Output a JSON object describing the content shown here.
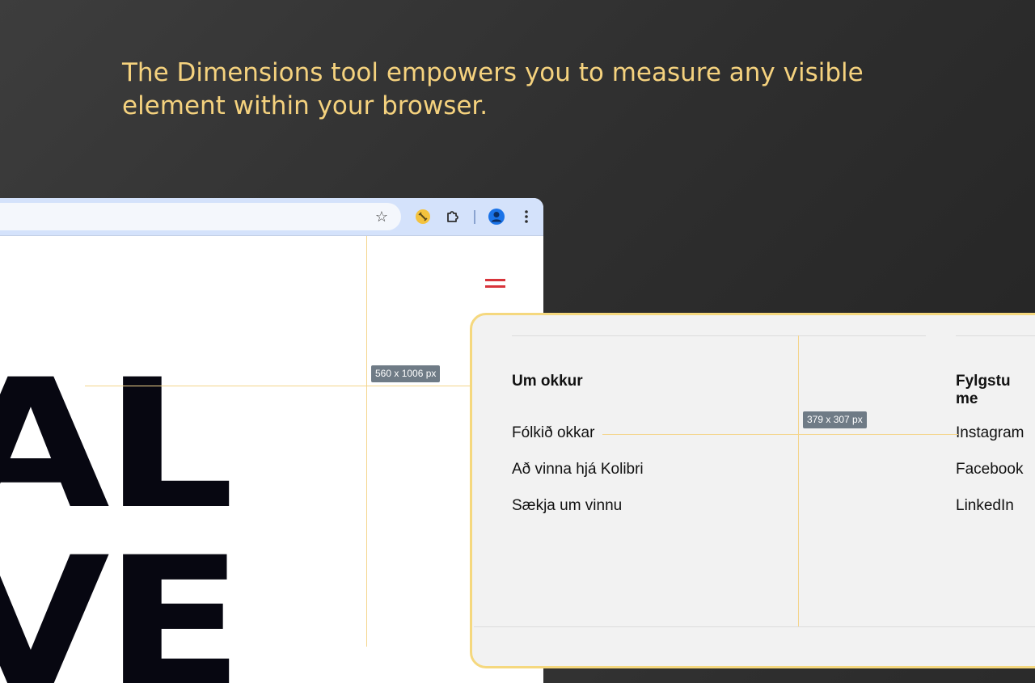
{
  "headline": "The Dimensions tool empowers you to measure any visible element within your browser.",
  "browser": {
    "toolbar_icons": [
      "star-icon",
      "dimensions-extension-icon",
      "puzzle-icon",
      "profile-icon",
      "more-vert-icon"
    ],
    "page_big_text": "AL\nVE",
    "measurement_label": "560 x 1006 px"
  },
  "card": {
    "measurement_label": "379 x 307 px",
    "col1": {
      "title": "Um okkur",
      "links": [
        "Fólkið okkar",
        "Að vinna hjá Kolibri",
        "Sækja um vinnu"
      ]
    },
    "col2": {
      "title": "Fylgstu me",
      "links": [
        "Instagram",
        "Facebook",
        "LinkedIn"
      ]
    }
  },
  "colors": {
    "headline": "#f5d27e",
    "accent": "#f5d87e",
    "hamburger": "#d8343a",
    "toolbar": "#d4e2fb"
  }
}
